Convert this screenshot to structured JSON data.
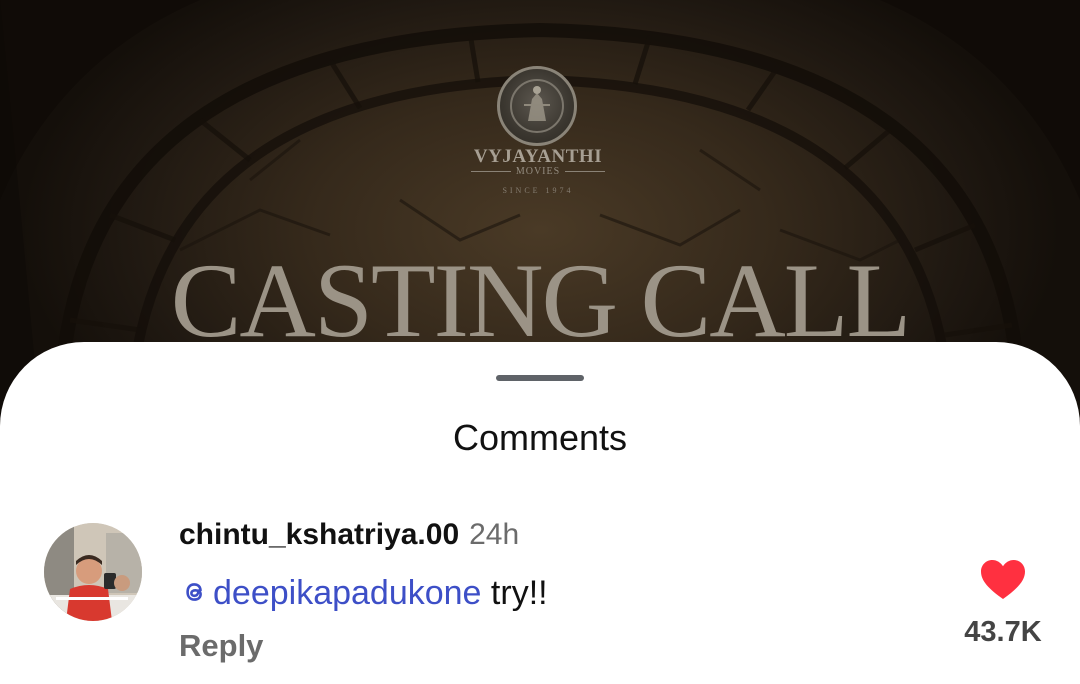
{
  "poster": {
    "brand_name": "VYJAYANTHI",
    "brand_sub": "MOVIES",
    "brand_since": "SINCE 1974",
    "headline": "CASTING CALL"
  },
  "comments_sheet": {
    "title": "Comments",
    "comment": {
      "username": "chintu_kshatriya.00",
      "time": "24h",
      "mention": "deepikapadukone",
      "text": "try!!",
      "reply_label": "Reply",
      "like_count": "43.7K"
    }
  },
  "colors": {
    "accent_heart": "#ff3040",
    "mention_link": "#3d4fc7",
    "sheet_background": "#ffffff"
  },
  "icons": {
    "logo": "vyjayanthi-logo-icon",
    "mention": "threads-icon",
    "like": "heart-filled-icon"
  }
}
